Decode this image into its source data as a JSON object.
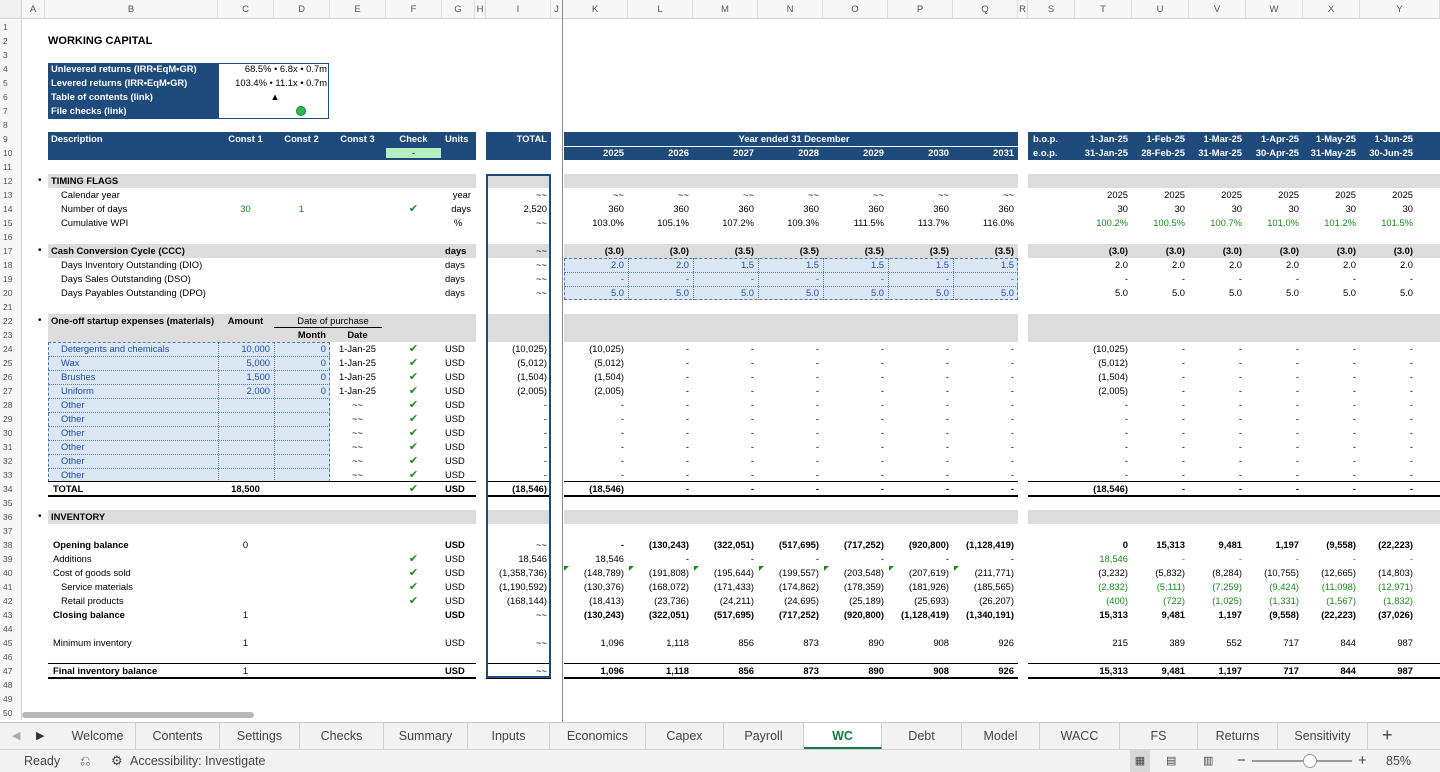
{
  "columns": [
    "A",
    "B",
    "C",
    "D",
    "E",
    "F",
    "G",
    "H",
    "I",
    "J",
    "K",
    "L",
    "M",
    "N",
    "O",
    "P",
    "Q",
    "R",
    "S",
    "T",
    "U",
    "V",
    "W",
    "X",
    "Y"
  ],
  "rows": [
    "1",
    "2",
    "3",
    "4",
    "5",
    "6",
    "7",
    "8",
    "9",
    "10",
    "11",
    "12",
    "13",
    "14",
    "15",
    "16",
    "17",
    "18",
    "19",
    "20",
    "21",
    "22",
    "23",
    "24",
    "25",
    "26",
    "27",
    "28",
    "29",
    "30",
    "31",
    "32",
    "33",
    "34",
    "35",
    "36",
    "37",
    "38",
    "39",
    "40",
    "41",
    "42",
    "43",
    "44",
    "45",
    "46",
    "47",
    "48",
    "49",
    "50"
  ],
  "title": "WORKING CAPITAL",
  "summary": {
    "unlev_label": "Unlevered returns (IRR•EqM•GR)",
    "unlev_val": "68.5% • 6.8x • 0.7m",
    "lev_label": "Levered returns (IRR•EqM•GR)",
    "lev_val": "103.4% • 11.1x • 0.7m",
    "toc": "Table of contents (link)",
    "toc_sym": "▲",
    "checks": "File checks (link)"
  },
  "header": {
    "desc": "Description",
    "c1": "Const 1",
    "c2": "Const 2",
    "c3": "Const 3",
    "check": "Check",
    "units": "Units",
    "total": "TOTAL",
    "check_val": "-",
    "year_ended": "Year ended 31 December",
    "years": [
      "2025",
      "2026",
      "2027",
      "2028",
      "2029",
      "2030",
      "2031"
    ],
    "bop": "b.o.p.",
    "eop": "e.o.p.",
    "m_start": [
      "1-Jan-25",
      "1-Feb-25",
      "1-Mar-25",
      "1-Apr-25",
      "1-May-25",
      "1-Jun-25"
    ],
    "m_end": [
      "31-Jan-25",
      "28-Feb-25",
      "31-Mar-25",
      "30-Apr-25",
      "31-May-25",
      "30-Jun-25"
    ]
  },
  "check_mark": "✔",
  "sections": {
    "timing": "TIMING FLAGS",
    "ccc": "Cash Conversion Cycle (CCC)",
    "startup": "One-off startup expenses (materials)",
    "inventory": "INVENTORY",
    "amount": "Amount",
    "date_of_purchase": "Date of purchase",
    "month": "Month",
    "date": "Date"
  },
  "timing": {
    "cal_label": "Calendar year",
    "cal_unit": "year",
    "cal_total": "~~",
    "cal_ann": [
      "~~",
      "~~",
      "~~",
      "~~",
      "~~",
      "~~",
      "~~"
    ],
    "cal_mon": [
      "2025",
      "2025",
      "2025",
      "2025",
      "2025",
      "2025"
    ],
    "nd_label": "Number of days",
    "nd_c1": "30",
    "nd_c2": "1",
    "nd_unit": "days",
    "nd_total": "2,520",
    "nd_ann": [
      "360",
      "360",
      "360",
      "360",
      "360",
      "360",
      "360"
    ],
    "nd_mon": [
      "30",
      "30",
      "30",
      "30",
      "30",
      "30"
    ],
    "wpi_label": "Cumulative WPI",
    "wpi_unit": "%",
    "wpi_total": "~~",
    "wpi_ann": [
      "103.0%",
      "105.1%",
      "107.2%",
      "109.3%",
      "111.5%",
      "113.7%",
      "116.0%"
    ],
    "wpi_mon": [
      "100.2%",
      "100.5%",
      "100.7%",
      "101.0%",
      "101.2%",
      "101.5%"
    ]
  },
  "ccc": {
    "unit": "days",
    "total": "~~",
    "ann": [
      "(3.0)",
      "(3.0)",
      "(3.5)",
      "(3.5)",
      "(3.5)",
      "(3.5)",
      "(3.5)"
    ],
    "mon": [
      "(3.0)",
      "(3.0)",
      "(3.0)",
      "(3.0)",
      "(3.0)",
      "(3.0)"
    ],
    "dio_label": "Days Inventory Outstanding (DIO)",
    "dio_ann": [
      "2.0",
      "2.0",
      "1.5",
      "1.5",
      "1.5",
      "1.5",
      "1.5"
    ],
    "dio_mon": [
      "2.0",
      "2.0",
      "2.0",
      "2.0",
      "2.0",
      "2.0"
    ],
    "dso_label": "Days Sales Outstanding (DSO)",
    "dso_ann": [
      "-",
      "-",
      "-",
      "-",
      "-",
      "-",
      "-"
    ],
    "dso_mon": [
      "-",
      "-",
      "-",
      "-",
      "-",
      "-"
    ],
    "dpo_label": "Days Payables Outstanding (DPO)",
    "dpo_ann": [
      "5.0",
      "5.0",
      "5.0",
      "5.0",
      "5.0",
      "5.0",
      "5.0"
    ],
    "dpo_mon": [
      "5.0",
      "5.0",
      "5.0",
      "5.0",
      "5.0",
      "5.0"
    ]
  },
  "startup": [
    {
      "label": "Detergents and chemicals",
      "amt": "10,000",
      "m": "0",
      "date": "1-Jan-25",
      "unit": "USD",
      "total": "(10,025)",
      "ann": [
        "(10,025)",
        "-",
        "-",
        "-",
        "-",
        "-",
        "-"
      ],
      "mon": [
        "(10,025)",
        "-",
        "-",
        "-",
        "-",
        "-"
      ]
    },
    {
      "label": "Wax",
      "amt": "5,000",
      "m": "0",
      "date": "1-Jan-25",
      "unit": "USD",
      "total": "(5,012)",
      "ann": [
        "(5,012)",
        "-",
        "-",
        "-",
        "-",
        "-",
        "-"
      ],
      "mon": [
        "(5,012)",
        "-",
        "-",
        "-",
        "-",
        "-"
      ]
    },
    {
      "label": "Brushes",
      "amt": "1,500",
      "m": "0",
      "date": "1-Jan-25",
      "unit": "USD",
      "total": "(1,504)",
      "ann": [
        "(1,504)",
        "-",
        "-",
        "-",
        "-",
        "-",
        "-"
      ],
      "mon": [
        "(1,504)",
        "-",
        "-",
        "-",
        "-",
        "-"
      ]
    },
    {
      "label": "Uniform",
      "amt": "2,000",
      "m": "0",
      "date": "1-Jan-25",
      "unit": "USD",
      "total": "(2,005)",
      "ann": [
        "(2,005)",
        "-",
        "-",
        "-",
        "-",
        "-",
        "-"
      ],
      "mon": [
        "(2,005)",
        "-",
        "-",
        "-",
        "-",
        "-"
      ]
    },
    {
      "label": "Other",
      "amt": "",
      "m": "",
      "date": "~~",
      "unit": "USD",
      "total": "-",
      "ann": [
        "-",
        "-",
        "-",
        "-",
        "-",
        "-",
        "-"
      ],
      "mon": [
        "-",
        "-",
        "-",
        "-",
        "-",
        "-"
      ]
    },
    {
      "label": "Other",
      "amt": "",
      "m": "",
      "date": "~~",
      "unit": "USD",
      "total": "-",
      "ann": [
        "-",
        "-",
        "-",
        "-",
        "-",
        "-",
        "-"
      ],
      "mon": [
        "-",
        "-",
        "-",
        "-",
        "-",
        "-"
      ]
    },
    {
      "label": "Other",
      "amt": "",
      "m": "",
      "date": "~~",
      "unit": "USD",
      "total": "-",
      "ann": [
        "-",
        "-",
        "-",
        "-",
        "-",
        "-",
        "-"
      ],
      "mon": [
        "-",
        "-",
        "-",
        "-",
        "-",
        "-"
      ]
    },
    {
      "label": "Other",
      "amt": "",
      "m": "",
      "date": "~~",
      "unit": "USD",
      "total": "-",
      "ann": [
        "-",
        "-",
        "-",
        "-",
        "-",
        "-",
        "-"
      ],
      "mon": [
        "-",
        "-",
        "-",
        "-",
        "-",
        "-"
      ]
    },
    {
      "label": "Other",
      "amt": "",
      "m": "",
      "date": "~~",
      "unit": "USD",
      "total": "-",
      "ann": [
        "-",
        "-",
        "-",
        "-",
        "-",
        "-",
        "-"
      ],
      "mon": [
        "-",
        "-",
        "-",
        "-",
        "-",
        "-"
      ]
    },
    {
      "label": "Other",
      "amt": "",
      "m": "",
      "date": "~~",
      "unit": "USD",
      "total": "-",
      "ann": [
        "-",
        "-",
        "-",
        "-",
        "-",
        "-",
        "-"
      ],
      "mon": [
        "-",
        "-",
        "-",
        "-",
        "-",
        "-"
      ]
    }
  ],
  "startup_total": {
    "label": "TOTAL",
    "amt": "18,500",
    "unit": "USD",
    "total": "(18,546)",
    "ann": [
      "(18,546)",
      "-",
      "-",
      "-",
      "-",
      "-",
      "-"
    ],
    "mon": [
      "(18,546)",
      "-",
      "-",
      "-",
      "-",
      "-"
    ]
  },
  "inventory": [
    {
      "label": "Opening balance",
      "bold": true,
      "c1": "0",
      "chk": false,
      "unit": "USD",
      "total": "~~",
      "ann": [
        "-",
        "(130,243)",
        "(322,051)",
        "(517,695)",
        "(717,252)",
        "(920,800)",
        "(1,128,419)"
      ],
      "mon": [
        "0",
        "15,313",
        "9,481",
        "1,197",
        "(9,558)",
        "(22,223)"
      ],
      "row": 38
    },
    {
      "label": "Additions",
      "bold": false,
      "c1": "",
      "chk": true,
      "unit": "USD",
      "total": "18,546",
      "ann": [
        "18,546",
        "-",
        "-",
        "-",
        "-",
        "-",
        "-"
      ],
      "mon": [
        "18,546",
        "-",
        "-",
        "-",
        "-",
        "-"
      ],
      "row": 39,
      "mgreen": true
    },
    {
      "label": "Cost of goods sold",
      "bold": false,
      "c1": "",
      "chk": true,
      "unit": "USD",
      "total": "(1,358,736)",
      "ann": [
        "(148,789)",
        "(191,808)",
        "(195,644)",
        "(199,557)",
        "(203,548)",
        "(207,619)",
        "(211,771)"
      ],
      "mon": [
        "(3,232)",
        "(5,832)",
        "(8,284)",
        "(10,755)",
        "(12,665)",
        "(14,803)"
      ],
      "row": 40
    },
    {
      "label": "Service materials",
      "bold": false,
      "indent": true,
      "c1": "",
      "chk": true,
      "unit": "USD",
      "total": "(1,190,592)",
      "ann": [
        "(130,376)",
        "(168,072)",
        "(171,433)",
        "(174,862)",
        "(178,359)",
        "(181,926)",
        "(185,565)"
      ],
      "mon": [
        "(2,832)",
        "(5,111)",
        "(7,259)",
        "(9,424)",
        "(11,098)",
        "(12,971)"
      ],
      "row": 41,
      "mgreen": true
    },
    {
      "label": "Retail products",
      "bold": false,
      "indent": true,
      "c1": "",
      "chk": true,
      "unit": "USD",
      "total": "(168,144)",
      "ann": [
        "(18,413)",
        "(23,736)",
        "(24,211)",
        "(24,695)",
        "(25,189)",
        "(25,693)",
        "(26,207)"
      ],
      "mon": [
        "(400)",
        "(722)",
        "(1,025)",
        "(1,331)",
        "(1,567)",
        "(1,832)"
      ],
      "row": 42,
      "mgreen": true
    },
    {
      "label": "Closing balance",
      "bold": true,
      "c1": "1",
      "chk": false,
      "unit": "USD",
      "total": "~~",
      "ann": [
        "(130,243)",
        "(322,051)",
        "(517,695)",
        "(717,252)",
        "(920,800)",
        "(1,128,419)",
        "(1,340,191)"
      ],
      "mon": [
        "15,313",
        "9,481",
        "1,197",
        "(9,558)",
        "(22,223)",
        "(37,026)"
      ],
      "row": 43
    },
    {
      "label": "Minimum inventory",
      "bold": false,
      "c1": "1",
      "chk": false,
      "unit": "USD",
      "total": "~~",
      "ann": [
        "1,096",
        "1,118",
        "856",
        "873",
        "890",
        "908",
        "926"
      ],
      "mon": [
        "215",
        "389",
        "552",
        "717",
        "844",
        "987"
      ],
      "row": 45
    },
    {
      "label": "Final inventory balance",
      "bold": true,
      "c1": "1",
      "chk": false,
      "unit": "USD",
      "total": "~~",
      "ann": [
        "1,096",
        "1,118",
        "856",
        "873",
        "890",
        "908",
        "926"
      ],
      "mon": [
        "15,313",
        "9,481",
        "1,197",
        "717",
        "844",
        "987"
      ],
      "row": 47
    }
  ],
  "tabs": [
    "Welcome",
    "Contents",
    "Settings",
    "Checks",
    "Summary",
    "Inputs",
    "Economics",
    "Capex",
    "Payroll",
    "WC",
    "Debt",
    "Model",
    "WACC",
    "FS",
    "Returns",
    "Sensitivity"
  ],
  "active_tab": "WC",
  "status": {
    "ready": "Ready",
    "accessibility": "Accessibility: Investigate",
    "zoom": "85%",
    "zoom_level": 0.85
  },
  "colors": {
    "header_band": "#1f4a7c",
    "excel_green": "#107c41",
    "input_blue": "#1f4ea8"
  }
}
